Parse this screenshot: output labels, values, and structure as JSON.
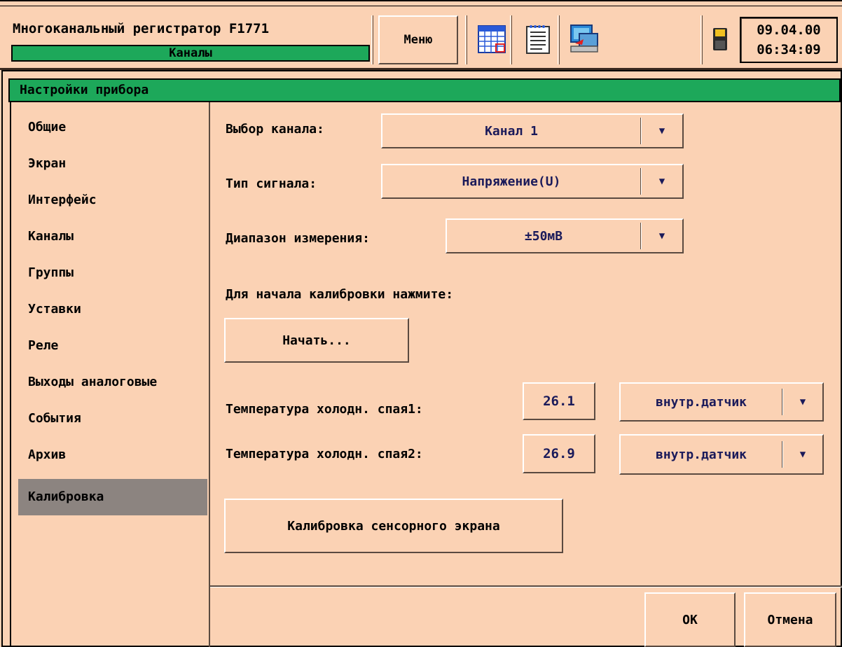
{
  "header": {
    "app_title": "Многоканальный регистратор F1771",
    "section": "Каналы",
    "menu_label": "Меню",
    "icons": [
      "table-icon",
      "document-icon",
      "computer-icon",
      "floppy-disk-icon"
    ],
    "date": "09.04.00",
    "time": "06:34:09"
  },
  "dialog": {
    "title": "Настройки прибора",
    "nav": [
      {
        "label": "Общие"
      },
      {
        "label": "Экран"
      },
      {
        "label": "Интерфейс"
      },
      {
        "label": "Каналы"
      },
      {
        "label": "Группы"
      },
      {
        "label": "Уставки"
      },
      {
        "label": "Реле"
      },
      {
        "label": "Выходы аналоговые"
      },
      {
        "label": "События"
      },
      {
        "label": "Архив"
      },
      {
        "label": "Калибровка",
        "selected": true
      }
    ],
    "channel_label": "Выбор канала:",
    "channel_value": "Канал 1",
    "signal_label": "Тип сигнала:",
    "signal_value": "Напряжение(U)",
    "range_label": "Диапазон измерения:",
    "range_value": "±50мВ",
    "calib_prompt": "Для начала калибровки нажмите:",
    "start_button": "Начать...",
    "cj1_label": "Температура холодн. спая1:",
    "cj1_value": "26.1",
    "cj1_source": "внутр.датчик",
    "cj2_label": "Температура холодн. спая2:",
    "cj2_value": "26.9",
    "cj2_source": "внутр.датчик",
    "touch_calib_button": "Калибровка сенсорного экрана",
    "ok_button": "OK",
    "cancel_button": "Отмена",
    "dropdown_arrow": "▼"
  },
  "colors": {
    "background": "#fbd2b4",
    "accent_green": "#1da85a",
    "selected_gray": "#8c8480",
    "value_text": "#1a1a5a"
  }
}
